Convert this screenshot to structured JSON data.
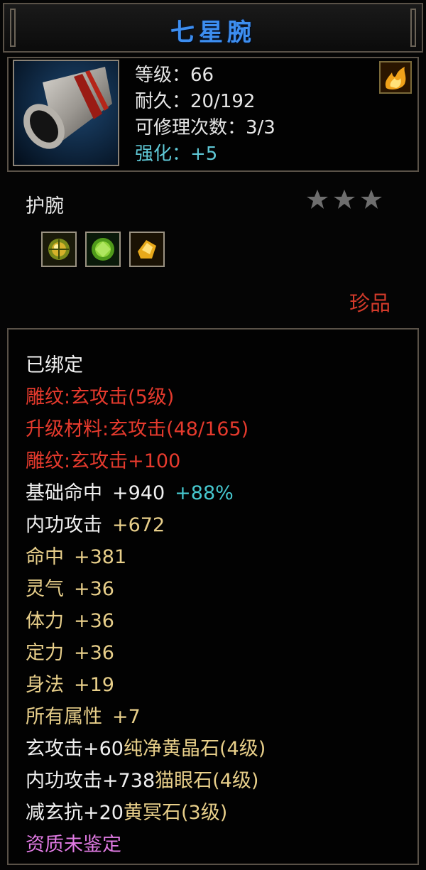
{
  "item": {
    "title": "七星腕"
  },
  "info": {
    "level": "等级：66",
    "durability": "耐久：20/192",
    "repair": "可修理次数：3/3",
    "enhance": "强化：+5"
  },
  "category": "护腕",
  "stars": {
    "count": 3,
    "color": "#6e6e6e"
  },
  "slots": [
    {
      "icon": "gold-green-gem-icon"
    },
    {
      "icon": "green-gem-icon"
    },
    {
      "icon": "yellow-crystal-icon"
    }
  ],
  "rarity": "珍品",
  "attributes": {
    "bound": "已绑定",
    "carve1": "雕纹:玄攻击(5级)",
    "upgrade": "升级材料:玄攻击(48/165)",
    "carve2": "雕纹:玄攻击+100",
    "base_hit_label": "基础命中",
    "base_hit_value": "+940",
    "base_hit_bonus": "+88%",
    "stats": [
      {
        "name": "内功攻击",
        "value": "+672"
      },
      {
        "name": "命中",
        "value": "+381"
      },
      {
        "name": "灵气",
        "value": "+36"
      },
      {
        "name": "体力",
        "value": "+36"
      },
      {
        "name": "定力",
        "value": "+36"
      },
      {
        "name": "身法",
        "value": "+19"
      },
      {
        "name": "所有属性",
        "value": "+7"
      }
    ],
    "gems": [
      {
        "bonus": "玄攻击+60",
        "gem": "纯净黄晶石(4级)"
      },
      {
        "bonus": "内功攻击+738",
        "gem": "猫眼石(4级)"
      },
      {
        "bonus": "减玄抗+20",
        "gem": "黄冥石(3级)"
      }
    ],
    "quality": "资质未鉴定"
  },
  "colors": {
    "title": "#3d8ef0",
    "red_text": "#e53a2d",
    "gold_text": "#e8cf8a",
    "cyan_text": "#46c8cf",
    "pink_text": "#e07ae3",
    "rarity": "#d23a2a"
  }
}
